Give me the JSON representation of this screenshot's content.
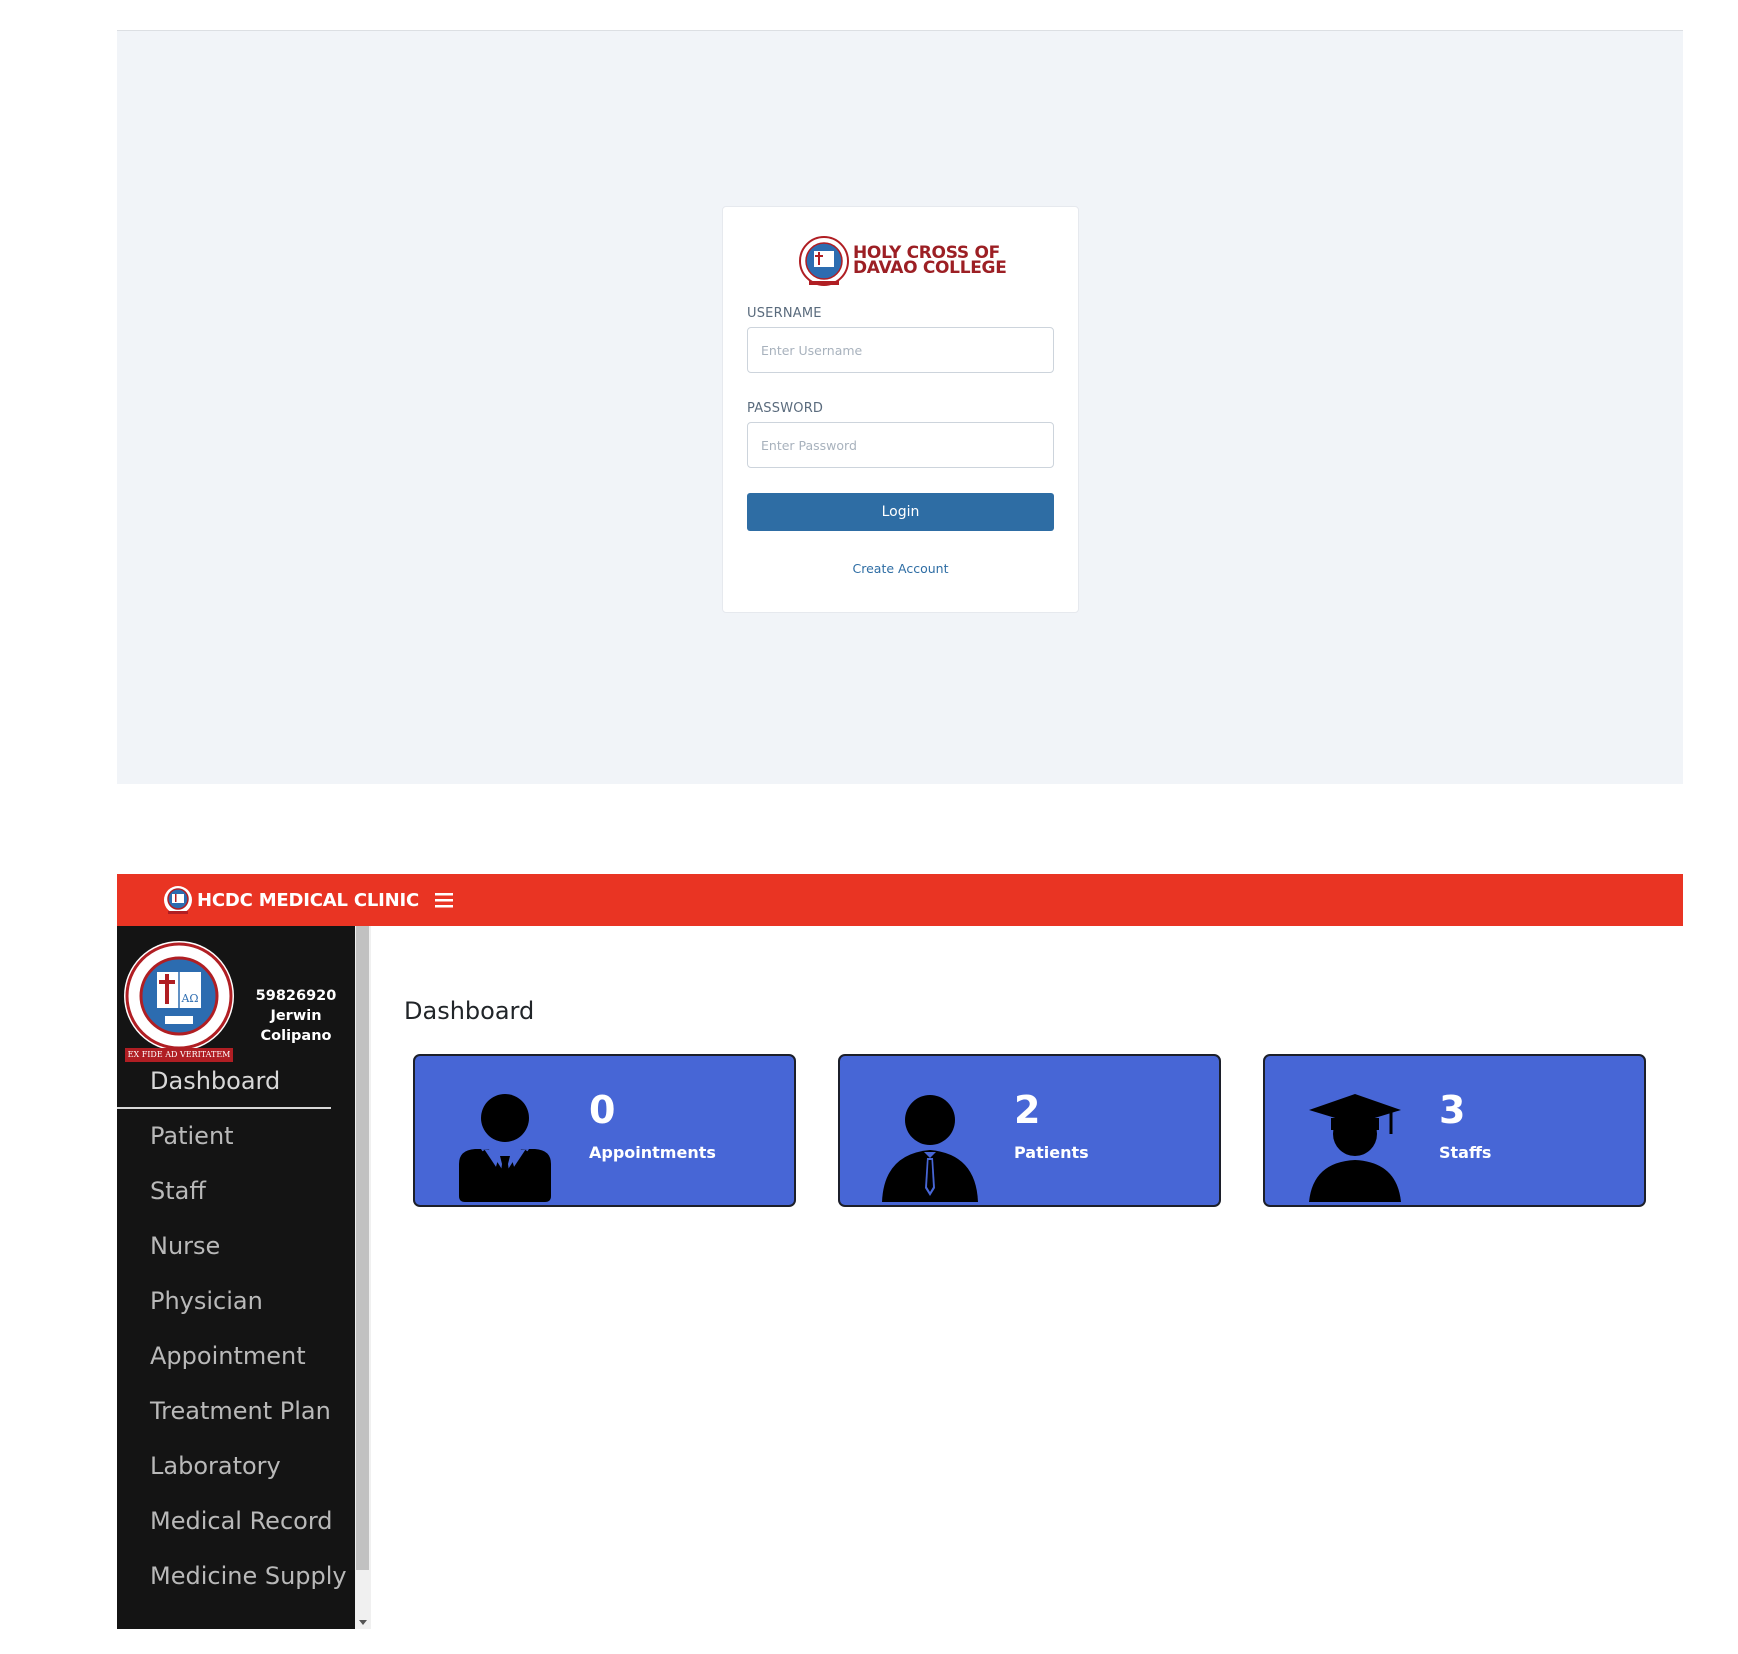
{
  "login": {
    "brand_line1": "HOLY CROSS OF",
    "brand_line2": "DAVAO COLLEGE",
    "username_label": "USERNAME",
    "username_placeholder": "Enter Username",
    "password_label": "PASSWORD",
    "password_placeholder": "Enter Password",
    "login_button": "Login",
    "create_account": "Create Account"
  },
  "dashboard": {
    "app_title": "HCDC MEDICAL CLINIC",
    "user_id": "59826920",
    "user_first": "Jerwin",
    "user_last": "Colipano",
    "motto": "EX FIDE AD VERITATEM",
    "page_title": "Dashboard",
    "nav": [
      {
        "label": "Dashboard"
      },
      {
        "label": "Patient"
      },
      {
        "label": "Staff"
      },
      {
        "label": "Nurse"
      },
      {
        "label": "Physician"
      },
      {
        "label": "Appointment"
      },
      {
        "label": "Treatment Plan"
      },
      {
        "label": "Laboratory"
      },
      {
        "label": "Medical Record"
      },
      {
        "label": "Medicine Supply"
      }
    ],
    "cards": [
      {
        "count": "0",
        "label": "Appointments",
        "icon": "businessman-icon"
      },
      {
        "count": "2",
        "label": "Patients",
        "icon": "person-tie-icon"
      },
      {
        "count": "3",
        "label": "Staffs",
        "icon": "graduate-icon"
      }
    ]
  },
  "colors": {
    "topbar": "#e93423",
    "sidebar": "#141414",
    "card": "#4766d6",
    "login_button": "#2e6da4",
    "brand": "#9c1f24"
  }
}
